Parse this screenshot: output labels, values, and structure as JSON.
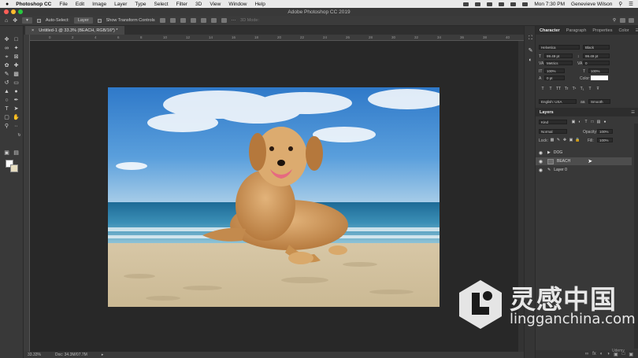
{
  "menubar": {
    "apple": "",
    "items": [
      "Photoshop CC",
      "File",
      "Edit",
      "Image",
      "Layer",
      "Type",
      "Select",
      "Filter",
      "3D",
      "View",
      "Window",
      "Help"
    ],
    "clock": "Mon 7:30 PM",
    "user": "Genevieve Wilson"
  },
  "window": {
    "title": "Adobe Photoshop CC 2019",
    "traffic_colors": [
      "#ff5f57",
      "#febc2e",
      "#28c840"
    ]
  },
  "options": {
    "auto_select_label": "Auto-Select:",
    "auto_select_target": "Layer",
    "transform_controls": "Show Transform Controls",
    "mode_3d": "3D Mode:"
  },
  "document": {
    "tab_title": "Untitled-1 @ 33.3% (BEACH, RGB/16*) *",
    "tab_close": "×",
    "zoom": "33.33%",
    "doc_info": "Doc: 34.3M/07.7M",
    "ruler_ticks": [
      "0",
      "2",
      "4",
      "6",
      "8",
      "10",
      "12",
      "14",
      "16",
      "18",
      "20",
      "22",
      "24",
      "26",
      "28",
      "30",
      "32",
      "34",
      "36",
      "38",
      "40"
    ]
  },
  "panels": {
    "tabs": [
      "Character",
      "Paragraph",
      "Properties",
      "Color"
    ],
    "character": {
      "font_family": "Helvetica",
      "font_style": "Black",
      "font_size": "99.49 pt",
      "leading": "99.49 pt",
      "kerning": "Metrics",
      "tracking": "0",
      "vscale": "100%",
      "hscale": "100%",
      "baseline": "0 pt",
      "color_label": "Color:",
      "format_buttons": [
        "T",
        "T",
        "TT",
        "Tr",
        "T¹",
        "T₁",
        "T",
        "Ŧ"
      ],
      "language": "English: USA",
      "aa_label": "aa",
      "antialias": "Smooth"
    },
    "layers": {
      "title": "Layers",
      "filter_kind": "Kind",
      "blend_mode": "Normal",
      "opacity_label": "Opacity:",
      "opacity": "100%",
      "lock_label": "Lock:",
      "fill_label": "Fill:",
      "fill": "100%",
      "rows": [
        {
          "name": "DOG",
          "selected": false
        },
        {
          "name": "BEACH",
          "selected": true
        },
        {
          "name": "Layer 0",
          "selected": false
        }
      ],
      "footer_icons": [
        "link-icon",
        "fx-icon",
        "mask-icon",
        "adjustment-icon",
        "folder-icon",
        "new-layer-icon",
        "trash-icon"
      ]
    }
  },
  "watermark": {
    "cn": "灵感中国",
    "en": "lingganchina.com"
  },
  "udemy": "Udemy"
}
